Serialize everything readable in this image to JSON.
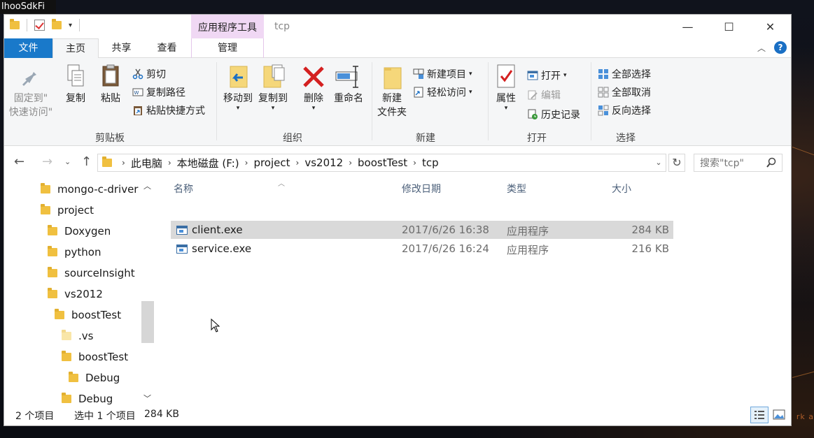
{
  "desktop": {
    "label": "lhooSdkFi",
    "corner_text": "rk a"
  },
  "titlebar": {
    "context_tab_header": "应用程序工具",
    "title": "tcp",
    "controls": {
      "minimize": "—",
      "maximize": "☐",
      "close": "✕"
    }
  },
  "tabs": {
    "file": "文件",
    "home": "主页",
    "share": "共享",
    "view": "查看",
    "manage": "管理"
  },
  "ribbon": {
    "clipboard": {
      "group": "剪贴板",
      "pin": [
        "固定到\"",
        "快速访问\""
      ],
      "copy": "复制",
      "paste": "粘贴",
      "cut": "剪切",
      "copy_path": "复制路径",
      "paste_shortcut": "粘贴快捷方式"
    },
    "organize": {
      "group": "组织",
      "move_to": "移动到",
      "copy_to": "复制到",
      "delete": "删除",
      "rename": "重命名"
    },
    "new": {
      "group": "新建",
      "new_folder": [
        "新建",
        "文件夹"
      ],
      "new_item": "新建项目",
      "easy_access": "轻松访问"
    },
    "open": {
      "group": "打开",
      "properties": "属性",
      "open": "打开",
      "edit": "编辑",
      "history": "历史记录"
    },
    "select": {
      "group": "选择",
      "select_all": "全部选择",
      "select_none": "全部取消",
      "invert": "反向选择"
    }
  },
  "address": {
    "crumbs": [
      "此电脑",
      "本地磁盘 (F:)",
      "project",
      "vs2012",
      "boostTest",
      "tcp"
    ],
    "search_placeholder": "搜索\"tcp\""
  },
  "navpane": {
    "items": [
      {
        "label": "mongo-c-driver",
        "level": 0
      },
      {
        "label": "project",
        "level": 0
      },
      {
        "label": "Doxygen",
        "level": 1
      },
      {
        "label": "python",
        "level": 1
      },
      {
        "label": "sourceInsight",
        "level": 1
      },
      {
        "label": "vs2012",
        "level": 1
      },
      {
        "label": "boostTest",
        "level": 2
      },
      {
        "label": ".vs",
        "level": 3
      },
      {
        "label": "boostTest",
        "level": 3
      },
      {
        "label": "Debug",
        "level": 4
      },
      {
        "label": "Debug",
        "level": 3
      }
    ]
  },
  "filelist": {
    "columns": [
      "名称",
      "修改日期",
      "类型",
      "大小"
    ],
    "rows": [
      {
        "name": "client.exe",
        "date": "2017/6/26 16:38",
        "type": "应用程序",
        "size": "284 KB",
        "selected": true
      },
      {
        "name": "service.exe",
        "date": "2017/6/26 16:24",
        "type": "应用程序",
        "size": "216 KB",
        "selected": false
      }
    ]
  },
  "status": {
    "count": "2 个项目",
    "selected": "选中 1 个项目",
    "selected_size": "284 KB"
  },
  "colors": {
    "accent": "#1979ca",
    "context_tab": "#f0d8f4",
    "selection": "#d9d9d9"
  }
}
